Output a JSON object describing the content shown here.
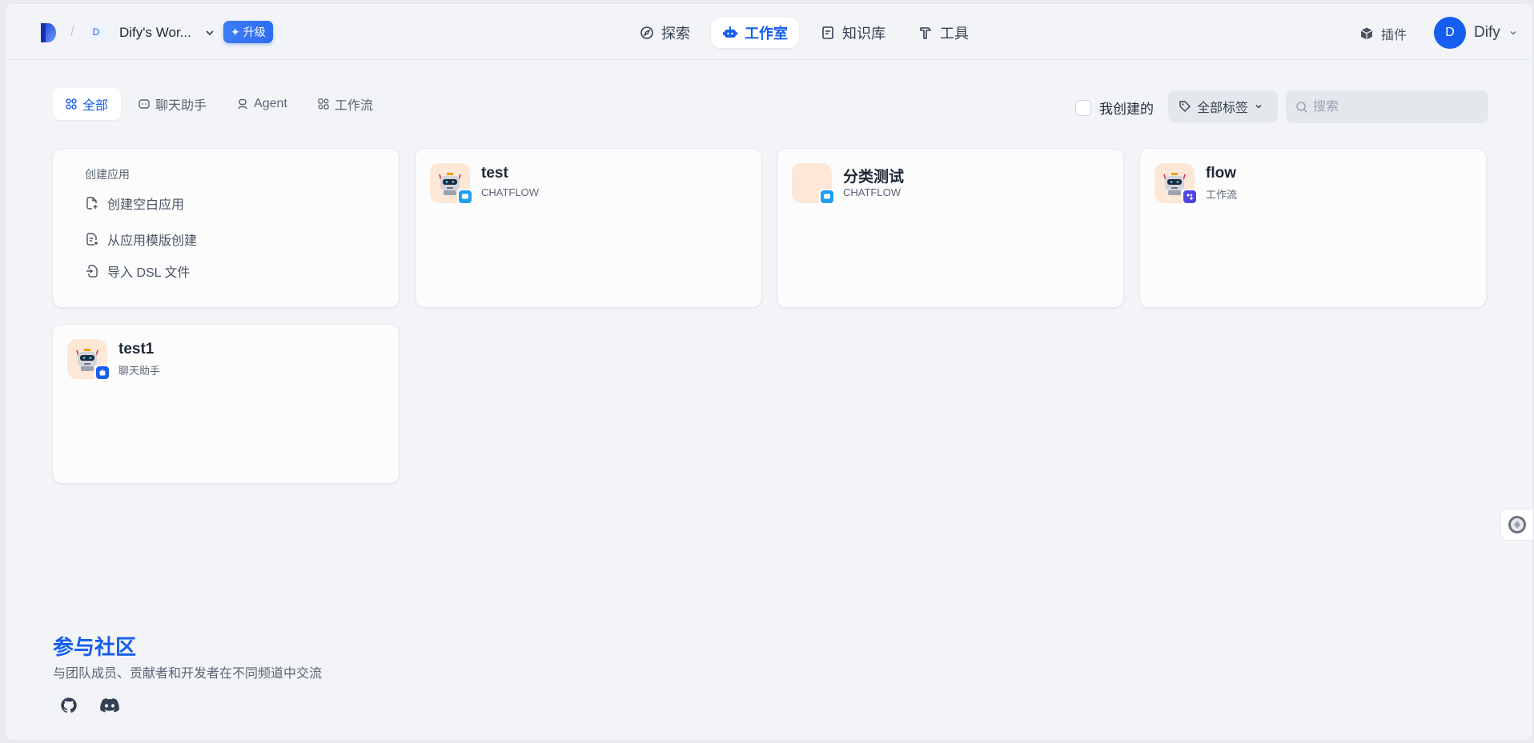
{
  "header": {
    "workspace_initial": "D",
    "workspace_name": "Dify's Wor...",
    "upgrade_label": "升级",
    "nav": [
      {
        "label": "探索",
        "icon": "compass-icon"
      },
      {
        "label": "工作室",
        "icon": "robot-icon",
        "active": true
      },
      {
        "label": "知识库",
        "icon": "book-icon"
      },
      {
        "label": "工具",
        "icon": "hammer-icon"
      }
    ],
    "plugins_label": "插件",
    "user_initial": "D",
    "user_name": "Dify"
  },
  "filters": {
    "tabs": [
      {
        "label": "全部",
        "icon": "grid-icon",
        "active": true
      },
      {
        "label": "聊天助手",
        "icon": "chat-bot-icon"
      },
      {
        "label": "Agent",
        "icon": "agent-icon"
      },
      {
        "label": "工作流",
        "icon": "workflow-icon"
      }
    ],
    "mine_label": "我创建的",
    "tag_label": "全部标签",
    "search_placeholder": "搜索"
  },
  "create_card": {
    "title": "创建应用",
    "blank": "创建空白应用",
    "template": "从应用模版创建",
    "import": "导入 DSL 文件"
  },
  "apps": [
    {
      "name": "test",
      "type": "CHATFLOW",
      "robot": true,
      "badge_color": "#1f9ef0"
    },
    {
      "name": "分类测试",
      "type": "CHATFLOW",
      "robot": false,
      "badge_color": "#1f9ef0"
    },
    {
      "name": "flow",
      "type": "工作流",
      "robot": true,
      "badge_color": "#4f46e5"
    },
    {
      "name": "test1",
      "type": "聊天助手",
      "robot": true,
      "badge_color": "#155eef"
    }
  ],
  "community": {
    "title": "参与社区",
    "subtitle": "与团队成员、贡献者和开发者在不同频道中交流"
  },
  "colors": {
    "accent": "#155eef",
    "background": "#f2f4f7",
    "app_icon_bg": "#fde7d6"
  }
}
